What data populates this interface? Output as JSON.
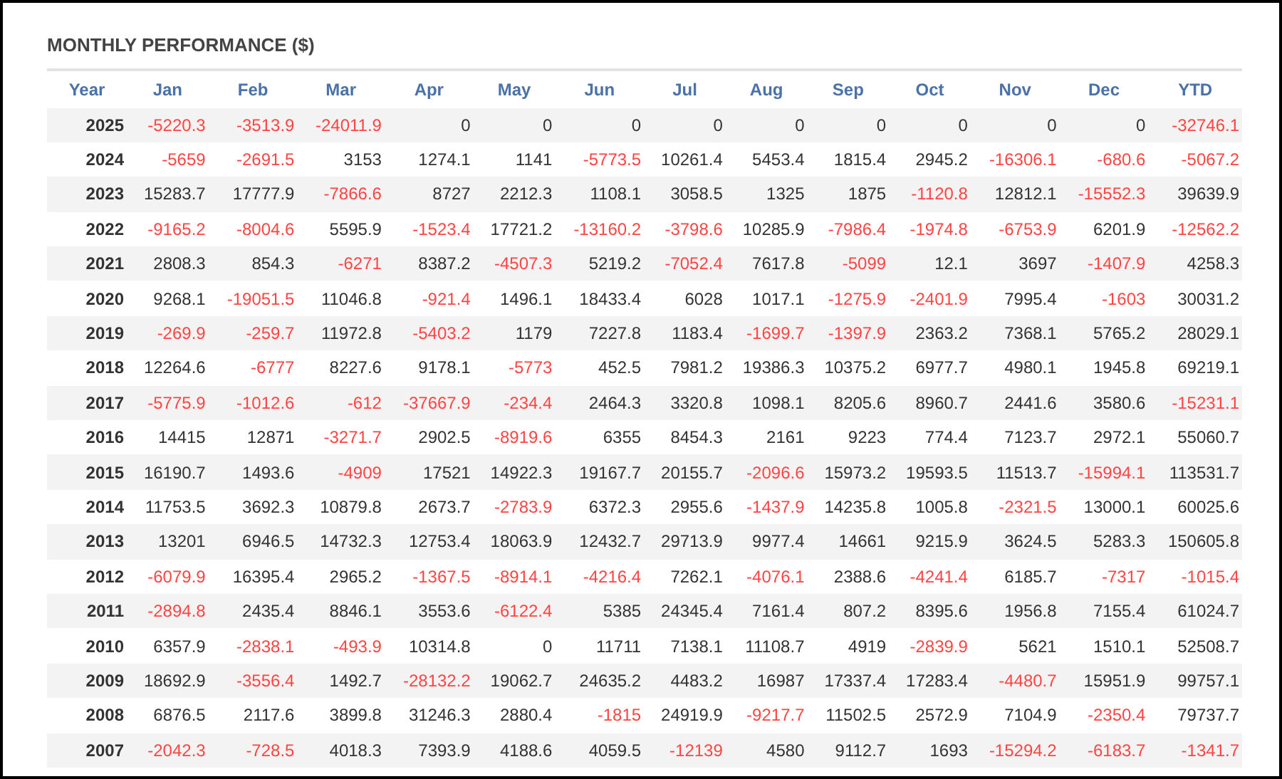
{
  "title": "MONTHLY PERFORMANCE ($)",
  "table": {
    "columns": [
      "Year",
      "Jan",
      "Feb",
      "Mar",
      "Apr",
      "May",
      "Jun",
      "Jul",
      "Aug",
      "Sep",
      "Oct",
      "Nov",
      "Dec",
      "YTD"
    ],
    "rows": [
      {
        "year": "2025",
        "values": [
          "-5220.3",
          "-3513.9",
          "-24011.9",
          "0",
          "0",
          "0",
          "0",
          "0",
          "0",
          "0",
          "0",
          "0",
          "-32746.1"
        ]
      },
      {
        "year": "2024",
        "values": [
          "-5659",
          "-2691.5",
          "3153",
          "1274.1",
          "1141",
          "-5773.5",
          "10261.4",
          "5453.4",
          "1815.4",
          "2945.2",
          "-16306.1",
          "-680.6",
          "-5067.2"
        ]
      },
      {
        "year": "2023",
        "values": [
          "15283.7",
          "17777.9",
          "-7866.6",
          "8727",
          "2212.3",
          "1108.1",
          "3058.5",
          "1325",
          "1875",
          "-1120.8",
          "12812.1",
          "-15552.3",
          "39639.9"
        ]
      },
      {
        "year": "2022",
        "values": [
          "-9165.2",
          "-8004.6",
          "5595.9",
          "-1523.4",
          "17721.2",
          "-13160.2",
          "-3798.6",
          "10285.9",
          "-7986.4",
          "-1974.8",
          "-6753.9",
          "6201.9",
          "-12562.2"
        ]
      },
      {
        "year": "2021",
        "values": [
          "2808.3",
          "854.3",
          "-6271",
          "8387.2",
          "-4507.3",
          "5219.2",
          "-7052.4",
          "7617.8",
          "-5099",
          "12.1",
          "3697",
          "-1407.9",
          "4258.3"
        ]
      },
      {
        "year": "2020",
        "values": [
          "9268.1",
          "-19051.5",
          "11046.8",
          "-921.4",
          "1496.1",
          "18433.4",
          "6028",
          "1017.1",
          "-1275.9",
          "-2401.9",
          "7995.4",
          "-1603",
          "30031.2"
        ]
      },
      {
        "year": "2019",
        "values": [
          "-269.9",
          "-259.7",
          "11972.8",
          "-5403.2",
          "1179",
          "7227.8",
          "1183.4",
          "-1699.7",
          "-1397.9",
          "2363.2",
          "7368.1",
          "5765.2",
          "28029.1"
        ]
      },
      {
        "year": "2018",
        "values": [
          "12264.6",
          "-6777",
          "8227.6",
          "9178.1",
          "-5773",
          "452.5",
          "7981.2",
          "19386.3",
          "10375.2",
          "6977.7",
          "4980.1",
          "1945.8",
          "69219.1"
        ]
      },
      {
        "year": "2017",
        "values": [
          "-5775.9",
          "-1012.6",
          "-612",
          "-37667.9",
          "-234.4",
          "2464.3",
          "3320.8",
          "1098.1",
          "8205.6",
          "8960.7",
          "2441.6",
          "3580.6",
          "-15231.1"
        ]
      },
      {
        "year": "2016",
        "values": [
          "14415",
          "12871",
          "-3271.7",
          "2902.5",
          "-8919.6",
          "6355",
          "8454.3",
          "2161",
          "9223",
          "774.4",
          "7123.7",
          "2972.1",
          "55060.7"
        ]
      },
      {
        "year": "2015",
        "values": [
          "16190.7",
          "1493.6",
          "-4909",
          "17521",
          "14922.3",
          "19167.7",
          "20155.7",
          "-2096.6",
          "15973.2",
          "19593.5",
          "11513.7",
          "-15994.1",
          "113531.7"
        ]
      },
      {
        "year": "2014",
        "values": [
          "11753.5",
          "3692.3",
          "10879.8",
          "2673.7",
          "-2783.9",
          "6372.3",
          "2955.6",
          "-1437.9",
          "14235.8",
          "1005.8",
          "-2321.5",
          "13000.1",
          "60025.6"
        ]
      },
      {
        "year": "2013",
        "values": [
          "13201",
          "6946.5",
          "14732.3",
          "12753.4",
          "18063.9",
          "12432.7",
          "29713.9",
          "9977.4",
          "14661",
          "9215.9",
          "3624.5",
          "5283.3",
          "150605.8"
        ]
      },
      {
        "year": "2012",
        "values": [
          "-6079.9",
          "16395.4",
          "2965.2",
          "-1367.5",
          "-8914.1",
          "-4216.4",
          "7262.1",
          "-4076.1",
          "2388.6",
          "-4241.4",
          "6185.7",
          "-7317",
          "-1015.4"
        ]
      },
      {
        "year": "2011",
        "values": [
          "-2894.8",
          "2435.4",
          "8846.1",
          "3553.6",
          "-6122.4",
          "5385",
          "24345.4",
          "7161.4",
          "807.2",
          "8395.6",
          "1956.8",
          "7155.4",
          "61024.7"
        ]
      },
      {
        "year": "2010",
        "values": [
          "6357.9",
          "-2838.1",
          "-493.9",
          "10314.8",
          "0",
          "11711",
          "7138.1",
          "11108.7",
          "4919",
          "-2839.9",
          "5621",
          "1510.1",
          "52508.7"
        ]
      },
      {
        "year": "2009",
        "values": [
          "18692.9",
          "-3556.4",
          "1492.7",
          "-28132.2",
          "19062.7",
          "24635.2",
          "4483.2",
          "16987",
          "17337.4",
          "17283.4",
          "-4480.7",
          "15951.9",
          "99757.1"
        ]
      },
      {
        "year": "2008",
        "values": [
          "6876.5",
          "2117.6",
          "3899.8",
          "31246.3",
          "2880.4",
          "-1815",
          "24919.9",
          "-9217.7",
          "11502.5",
          "2572.9",
          "7104.9",
          "-2350.4",
          "79737.7"
        ]
      },
      {
        "year": "2007",
        "values": [
          "-2042.3",
          "-728.5",
          "4018.3",
          "7393.9",
          "4188.6",
          "4059.5",
          "-12139",
          "4580",
          "9112.7",
          "1693",
          "-15294.2",
          "-6183.7",
          "-1341.7"
        ]
      }
    ]
  }
}
